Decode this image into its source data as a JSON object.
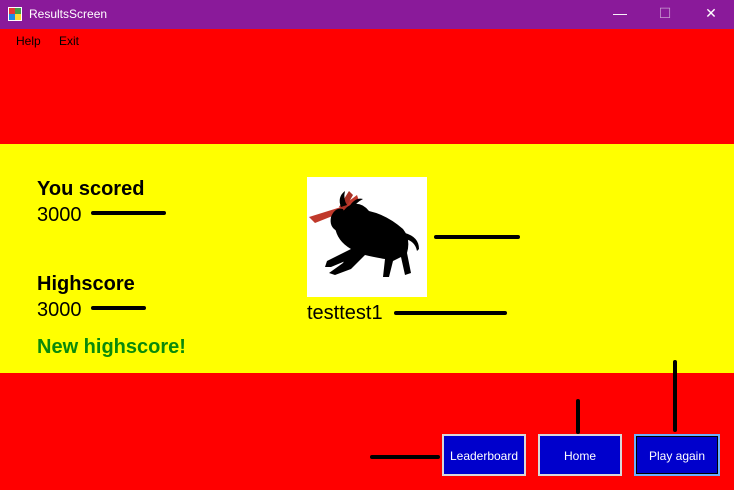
{
  "window": {
    "title": "ResultsScreen",
    "minimize": "—",
    "maximize": "☐",
    "close": "✕"
  },
  "menu": {
    "items": [
      "Help",
      "Exit"
    ]
  },
  "score": {
    "label": "You scored",
    "value": "3000"
  },
  "highscore": {
    "label": "Highscore",
    "value": "3000",
    "message": "New highscore!"
  },
  "player": {
    "name": "testtest1",
    "image_icon": "bull-icon"
  },
  "buttons": {
    "leaderboard": "Leaderboard",
    "home": "Home",
    "play_again": "Play again"
  },
  "colors": {
    "titlebar": "#8a1a9a",
    "flag_red": "#ff0000",
    "flag_yellow": "#ffff00",
    "button_blue": "#0000cc",
    "highscore_green": "#0a8a0a"
  }
}
